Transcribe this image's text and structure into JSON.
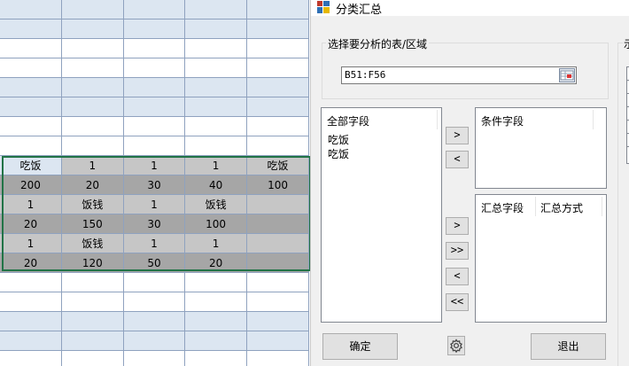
{
  "sheet": {
    "rows": [
      {
        "type": "blue",
        "cells": [
          "",
          "",
          "",
          "",
          ""
        ]
      },
      {
        "type": "blue",
        "cells": [
          "",
          "",
          "",
          "",
          ""
        ]
      },
      {
        "type": "white",
        "cells": [
          "",
          "",
          "",
          "",
          ""
        ]
      },
      {
        "type": "white",
        "cells": [
          "",
          "",
          "",
          "",
          ""
        ]
      },
      {
        "type": "blue",
        "cells": [
          "",
          "",
          "",
          "",
          ""
        ]
      },
      {
        "type": "blue",
        "cells": [
          "",
          "",
          "",
          "",
          ""
        ]
      },
      {
        "type": "white",
        "cells": [
          "",
          "",
          "",
          "",
          ""
        ]
      },
      {
        "type": "white",
        "cells": [
          "",
          "",
          "",
          "",
          ""
        ]
      },
      {
        "type": "sel-b",
        "cells": [
          "吃饭",
          "1",
          "1",
          "1",
          "吃饭"
        ]
      },
      {
        "type": "sel-a",
        "cells": [
          "200",
          "20",
          "30",
          "40",
          "100"
        ]
      },
      {
        "type": "sel-b",
        "cells": [
          "1",
          "饭钱",
          "1",
          "饭钱",
          ""
        ]
      },
      {
        "type": "sel-a",
        "cells": [
          "20",
          "150",
          "30",
          "100",
          ""
        ]
      },
      {
        "type": "sel-b",
        "cells": [
          "1",
          "饭钱",
          "1",
          "1",
          ""
        ]
      },
      {
        "type": "sel-a",
        "cells": [
          "20",
          "120",
          "50",
          "20",
          ""
        ]
      },
      {
        "type": "white",
        "cells": [
          "",
          "",
          "",
          "",
          ""
        ]
      },
      {
        "type": "white",
        "cells": [
          "",
          "",
          "",
          "",
          ""
        ]
      },
      {
        "type": "blue",
        "cells": [
          "",
          "",
          "",
          "",
          ""
        ]
      },
      {
        "type": "blue",
        "cells": [
          "",
          "",
          "",
          "",
          ""
        ]
      },
      {
        "type": "white",
        "cells": [
          "",
          "",
          "",
          "",
          ""
        ]
      }
    ]
  },
  "dialog": {
    "title": "分类汇总",
    "group_label": "选择要分析的表/区域",
    "range_value": "B51:F56",
    "all_fields_header": "全部字段",
    "all_fields": [
      "吃饭",
      "吃饭"
    ],
    "condition_header": "条件字段",
    "summary_field_header": "汇总字段",
    "summary_method_header": "汇总方式",
    "buttons": {
      "add_condition": ">",
      "remove_condition": "<",
      "add_summary": ">",
      "add_all_summary": ">>",
      "remove_summary": "<",
      "remove_all_summary": "<<",
      "ok": "确定",
      "exit": "退出"
    },
    "right_group_label": "示"
  }
}
